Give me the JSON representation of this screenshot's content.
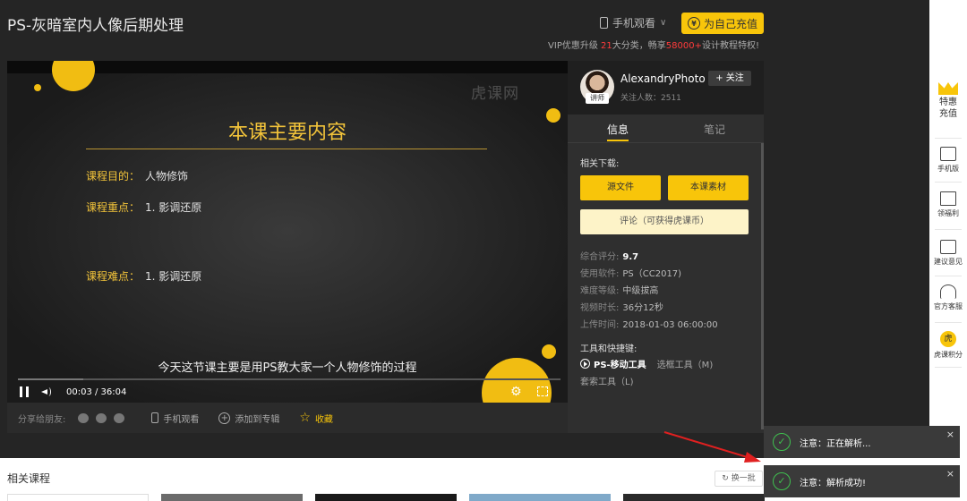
{
  "header": {
    "title": "PS-灰暗室内人像后期处理",
    "mobile_watch": "手机观看",
    "recharge": "为自己充值",
    "vip_pre": "VIP优惠升级 ",
    "vip_num1": "21",
    "vip_mid": "大分类，畅享",
    "vip_num2": "58000+",
    "vip_post": "设计教程特权!"
  },
  "video": {
    "watermark": "虎课网",
    "slide_title": "本课主要内容",
    "rows": [
      {
        "key": "课程目的：",
        "val": "人物修饰"
      },
      {
        "key": "课程重点：",
        "val": "1. 影调还原"
      },
      {
        "key": "课程难点：",
        "val": "1. 影调还原"
      }
    ],
    "subtitle": "今天这节课主要是用PS教大家一个人物修饰的过程",
    "time": "00:03 / 36:04",
    "progress": 0.12
  },
  "sharebar": {
    "share_label": "分享给朋友:",
    "mobile": "手机观看",
    "add": "添加到专辑",
    "collect": "收藏"
  },
  "panel": {
    "author": "AlexandryPhoto",
    "badge": "讲师",
    "followers": "关注人数：2511",
    "follow": "关注",
    "tab_info": "信息",
    "tab_notes": "笔记",
    "downloads_label": "相关下载:",
    "btn_source": "源文件",
    "btn_material": "本课素材",
    "btn_comment": "评论（可获得虎课币）",
    "meta": [
      {
        "k": "综合评分:",
        "v": "9.7"
      },
      {
        "k": "使用软件:",
        "v": "PS（CC2017)"
      },
      {
        "k": "难度等级:",
        "v": "中级拔高"
      },
      {
        "k": "视频时长:",
        "v": "36分12秒"
      },
      {
        "k": "上传时间:",
        "v": "2018-01-03 06:00:00"
      }
    ],
    "tools_label": "工具和快捷键:",
    "tool_main": "PS-移动工具",
    "tool_sec": "选框工具（M)",
    "tool_row2": "套索工具（L)"
  },
  "sidebar": {
    "items": [
      "特惠\n充值",
      "手机版",
      "领福利",
      "建议意见",
      "官方客服",
      "虎课积分"
    ],
    "coin": "虎"
  },
  "bottom": {
    "related": "相关课程",
    "swap": "换一批"
  },
  "toasts": [
    "注意：正在解析...",
    "注意：解析成功!"
  ],
  "colors": {
    "accent": "#f8c50a",
    "success": "#3fbf4f",
    "highlight": "#ff3b3b"
  }
}
